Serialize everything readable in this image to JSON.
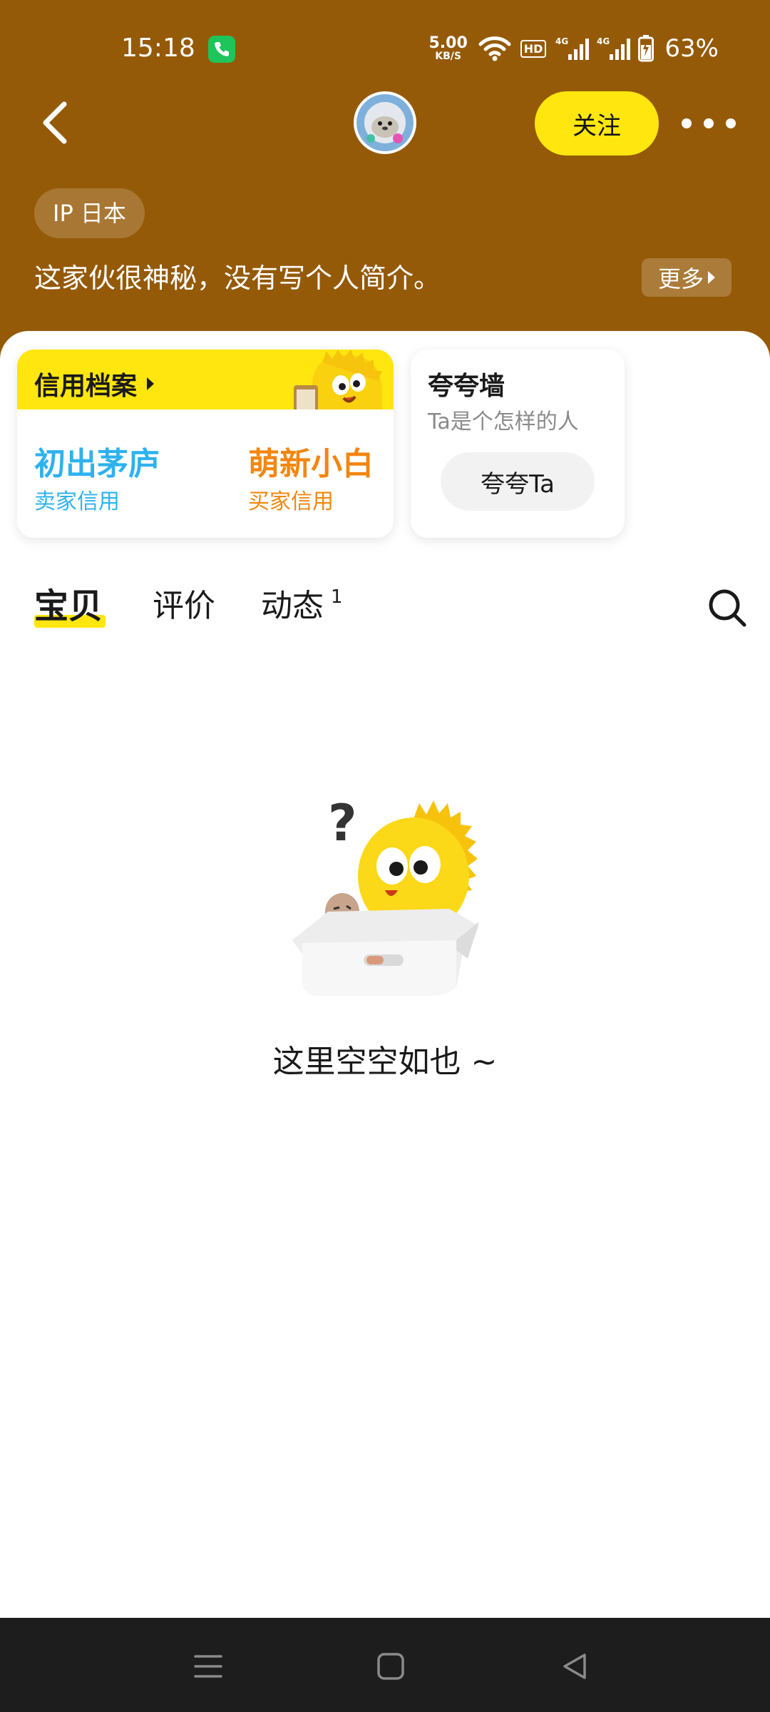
{
  "status_bar": {
    "time": "15:18",
    "net_speed_value": "5.00",
    "net_speed_unit": "KB/S",
    "hd_label": "HD",
    "battery_pct": "63%"
  },
  "nav": {
    "follow_label": "关注"
  },
  "profile": {
    "ip_label": "IP 日本",
    "bio": "这家伙很神秘，没有写个人简介。",
    "more_label": "更多"
  },
  "credit": {
    "title": "信用档案",
    "seller_level": "初出茅庐",
    "seller_caption": "卖家信用",
    "buyer_level": "萌新小白",
    "buyer_caption": "买家信用"
  },
  "praise": {
    "title": "夸夸墙",
    "subtitle": "Ta是个怎样的人",
    "button_label": "夸夸Ta"
  },
  "tabs": [
    {
      "label": "宝贝",
      "active": true
    },
    {
      "label": "评价",
      "active": false
    },
    {
      "label": "动态",
      "badge": "1",
      "active": false
    }
  ],
  "empty_state": {
    "text": "这里空空如也 ~"
  },
  "colors": {
    "header_bg": "#955a08",
    "accent_yellow": "#ffe60f",
    "seller_blue": "#2db2ee",
    "buyer_orange": "#f3860f"
  }
}
